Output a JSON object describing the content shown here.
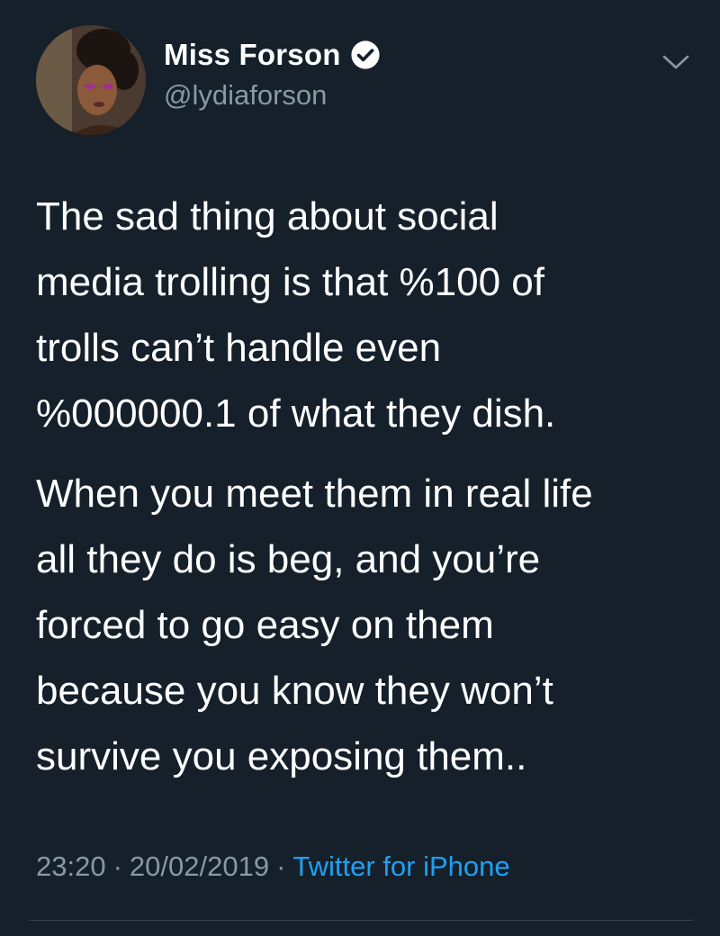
{
  "tweet": {
    "author": {
      "display_name": "Miss Forson",
      "handle": "@lydiaforson",
      "verified": true
    },
    "body": {
      "paragraph1": [
        "The sad thing about social",
        "media trolling is that %100 of",
        "trolls can’t handle even",
        "%000000.1 of what they dish."
      ],
      "paragraph2": [
        "When you meet them in real life",
        "all they do is beg, and you’re",
        "forced to go easy on them",
        "because you know they won’t",
        "survive you exposing them.."
      ]
    },
    "meta": {
      "time": "23:20",
      "separator": "·",
      "date": "20/02/2019",
      "source": "Twitter for iPhone"
    },
    "icons": {
      "verified": "verified-badge-icon",
      "more": "chevron-down-icon"
    }
  },
  "colors": {
    "background": "#15202b",
    "text": "#ffffff",
    "secondary": "#8899a6",
    "link": "#1da1f2",
    "divider": "#38444d"
  }
}
